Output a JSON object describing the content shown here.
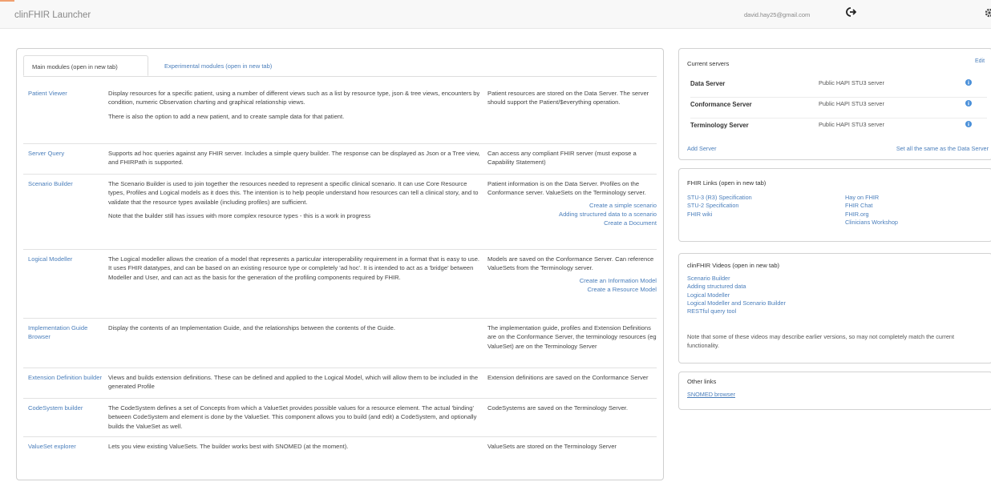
{
  "header": {
    "brand": "clinFHIR Launcher",
    "user_email": "david.hay25@gmail.com",
    "icons": {
      "logout": "logout-icon",
      "settings": "gear-icon"
    },
    "accent_color": "#f0a070"
  },
  "tabs": [
    {
      "label": "Main modules (open in new tab)",
      "active": true
    },
    {
      "label": "Experimental modules (open in new tab)",
      "active": false
    }
  ],
  "modules": [
    {
      "name": "Patient Viewer",
      "description": [
        "Display resources for a specific patient, using a number of different views such as a list by resource type, json & tree views, encounters by condition, numeric Observation charting and graphical relationship views.",
        "There is also the option to add a new patient, and to create sample data for that patient."
      ],
      "notes": "Patient resources are stored on the Data Server. The server should support the Patient/$everything operation.",
      "links": []
    },
    {
      "name": "Server Query",
      "description": [
        "Supports ad hoc queries against any FHIR server. Includes a simple query builder. The response can be displayed as Json or a Tree view, and FHIRPath is supported."
      ],
      "notes": "Can access any compliant FHIR server (must expose a Capability Statement)",
      "links": []
    },
    {
      "name": "Scenario Builder",
      "description": [
        "The Scenario Builder is used to join together the resources needed to represent a specific clinical scenario. It can use Core Resource types, Profiles and Logical models as it does this. The intention is to help people understand how resources can tell a clinical story, and to validate that the resource types available (including profiles) are sufficient.",
        "Note that the builder still has issues with more complex resource types - this is a work in progress"
      ],
      "notes": "Patient information is on the Data Server. Profiles on the Conformance server. ValueSets on the Terminology server.",
      "links": [
        "Create a simple scenario",
        "Adding structured data to a scenario",
        "Create a Document"
      ]
    },
    {
      "name": "Logical Modeller",
      "description": [
        "The Logical modeller allows the creation of a model that represents a particular interoperability requirement in a format that is easy to use. It uses FHIR datatypes, and can be based on an existing resource type or completely 'ad hoc'. It is intended to act as a 'bridge' between Modeller and User, and can act as the basis for the generation of the profiling components required by FHIR."
      ],
      "notes": "Models are saved on the Conformance Server. Can reference ValueSets from the Terminology server.",
      "links": [
        "Create an Information Model",
        "Create a Resource Model"
      ]
    },
    {
      "name": "Implementation Guide Browser",
      "description": [
        "Display the contents of an Implementation Guide, and the relationships between the contents of the Guide."
      ],
      "notes": "The implementation guide, profiles and Extension Definitions are on the Conformance Server, the terminology resources (eg ValueSet) are on the Terminology Server",
      "links": []
    },
    {
      "name": "Extension Definition builder",
      "description": [
        "Views and builds extension definitions. These can be defined and applied to the Logical Model, which will allow them to be included in the generated Profile"
      ],
      "notes": "Extension definitions are saved on the Conformance Server",
      "links": []
    },
    {
      "name": "CodeSystem builder",
      "description": [
        "The CodeSystem defines a set of Concepts from which a ValueSet provides possible values for a resource element. The actual 'binding' between CodeSystem and element is done by the ValueSet. This component allows you to build (and edit) a CodeSystem, and optionally builds the ValueSet as well."
      ],
      "notes": "CodeSystems are saved on the Terminology Server.",
      "links": []
    },
    {
      "name": "ValueSet explorer",
      "description": [
        "Lets you view existing ValueSets. The builder works best with SNOMED (at the moment)."
      ],
      "notes": "ValueSets are stored on the Terminology Server",
      "links": []
    }
  ],
  "servers_panel": {
    "title": "Current servers",
    "edit_label": "Edit",
    "rows": [
      {
        "name": "Data Server",
        "value": "Public HAPI STU3 server"
      },
      {
        "name": "Conformance Server",
        "value": "Public HAPI STU3 server"
      },
      {
        "name": "Terminology Server",
        "value": "Public HAPI STU3 server"
      }
    ],
    "add_server_label": "Add Server",
    "set_all_label": "Set all the same as the Data Server",
    "info_color": "#4a90d9"
  },
  "fhir_links_panel": {
    "title": "FHIR Links (open in new tab)",
    "left": [
      "STU-3 (R3) Specification",
      "STU-2 Specification",
      "FHIR wiki"
    ],
    "right": [
      "Hay on FHIR",
      "FHIR Chat",
      "FHIR.org",
      "Clinicians Workshop"
    ]
  },
  "videos_panel": {
    "title": "clinFHIR Videos (open in new tab)",
    "items": [
      "Scenario Builder",
      "Adding structured data",
      "Logical Modeller",
      "Logical Modeller and Scenario Builder",
      "RESTful query tool"
    ],
    "note": "Note that some of these videos may describe earlier versions, so may not completely match the current functionality."
  },
  "other_links_panel": {
    "title": "Other links",
    "items": [
      "SNOMED browser"
    ]
  }
}
